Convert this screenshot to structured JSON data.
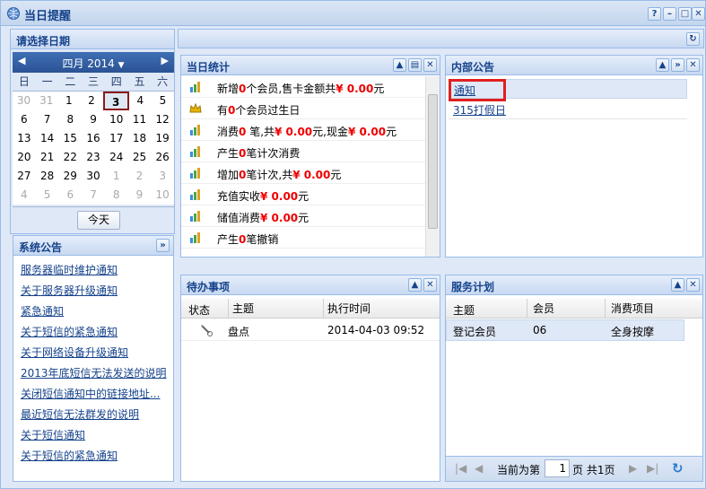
{
  "window": {
    "title": "当日提醒"
  },
  "calendar": {
    "panel_title": "请选择日期",
    "month_label": "四月 2014",
    "weekdays": [
      "日",
      "一",
      "二",
      "三",
      "四",
      "五",
      "六"
    ],
    "weeks": [
      [
        "30",
        "31",
        "1",
        "2",
        "3",
        "4",
        "5"
      ],
      [
        "6",
        "7",
        "8",
        "9",
        "10",
        "11",
        "12"
      ],
      [
        "13",
        "14",
        "15",
        "16",
        "17",
        "18",
        "19"
      ],
      [
        "20",
        "21",
        "22",
        "23",
        "24",
        "25",
        "26"
      ],
      [
        "27",
        "28",
        "29",
        "30",
        "1",
        "2",
        "3"
      ],
      [
        "4",
        "5",
        "6",
        "7",
        "8",
        "9",
        "10"
      ]
    ],
    "selected": "3",
    "today_button": "今天"
  },
  "system_notice": {
    "title": "系统公告",
    "items": [
      "服务器临时维护通知",
      "关于服务器升级通知",
      "紧急通知",
      "关于短信的紧急通知",
      "关于网络设备升级通知",
      "2013年底短信无法发送的说明",
      "关闭短信通知中的链接地址...",
      "最近短信无法群发的说明",
      "关于短信通知",
      "关于短信的紧急通知"
    ]
  },
  "daily_stats": {
    "title": "当日统计",
    "rows": [
      {
        "pre": "新增",
        "n1": "0",
        "mid": "个会员,售卡金额共",
        "amt": "¥ 0.00",
        "post": "元",
        "icon": "chart-up-icon"
      },
      {
        "pre": "有",
        "n1": "0",
        "mid": "个会员过生日",
        "amt": "",
        "post": "",
        "icon": "crown-icon"
      },
      {
        "pre": "消费",
        "n1": "0",
        "mid": " 笔,共",
        "amt": "¥ 0.00",
        "post": "元,现金",
        "amt2": "¥ 0.00",
        "post2": "元",
        "icon": "chart-icon"
      },
      {
        "pre": "产生",
        "n1": "0",
        "mid": "笔计次消费",
        "amt": "",
        "post": "",
        "icon": "chart-icon"
      },
      {
        "pre": "增加",
        "n1": "0",
        "mid": "笔计次,共",
        "amt": "¥ 0.00",
        "post": "元",
        "icon": "chart-icon"
      },
      {
        "pre": "充值实收",
        "n1": "",
        "mid": "",
        "amt": "¥ 0.00",
        "post": "元",
        "icon": "chart-icon"
      },
      {
        "pre": "储值消费",
        "n1": "",
        "mid": "",
        "amt": "¥ 0.00",
        "post": "元",
        "icon": "chart-icon"
      },
      {
        "pre": "产生",
        "n1": "0",
        "mid": "笔撤销",
        "amt": "",
        "post": "",
        "icon": "chart-icon"
      }
    ]
  },
  "internal_notice": {
    "title": "内部公告",
    "items": [
      "通知",
      "315打假日"
    ]
  },
  "todo": {
    "title": "待办事项",
    "columns": [
      "状态",
      "主题",
      "执行时间"
    ],
    "rows": [
      {
        "status_icon": "tools-icon",
        "subject": "盘点",
        "time": "2014-04-03 09:52"
      }
    ]
  },
  "service_plan": {
    "title": "服务计划",
    "columns": [
      "主题",
      "会员",
      "消费项目"
    ],
    "rows": [
      {
        "subject": "登记会员",
        "member": "06",
        "item": "全身按摩"
      }
    ],
    "pager": {
      "prefix": "当前为第",
      "page": "1",
      "suffix": "页 共1页"
    }
  },
  "colors": {
    "accent": "#15428b",
    "border": "#99bbe8",
    "amount": "#e00000",
    "highlight": "#e02020"
  }
}
